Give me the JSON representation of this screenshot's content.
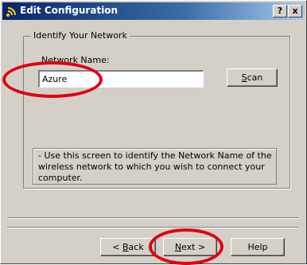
{
  "window": {
    "title": "Edit Configuration",
    "help_button": "?",
    "close_button": "x"
  },
  "group": {
    "legend": "Identify Your Network",
    "name_label_prefix": "N",
    "name_label_rest": "etwork Name:"
  },
  "network_name": {
    "value": "Azure",
    "placeholder": ""
  },
  "scan_button": {
    "mnemonic": "S",
    "rest": "can"
  },
  "info": {
    "text": "- Use this screen to identify the Network Name of the wireless network to which you wish to connect your computer."
  },
  "buttons": {
    "back_prefix": "< ",
    "back_mnemonic": "B",
    "back_rest": "ack",
    "next_mnemonic": "N",
    "next_rest": "ext >",
    "help": "Help"
  },
  "annotations": {
    "color": "#e00010"
  },
  "colors": {
    "dialog_bg": "#d4d0c8",
    "titlebar": "#0a246a"
  },
  "icons": {
    "title": "wireless-signal-icon"
  }
}
